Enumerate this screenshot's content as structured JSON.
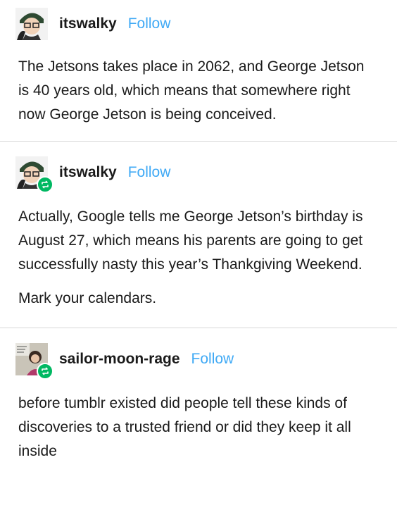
{
  "posts": [
    {
      "username": "itswalky",
      "follow_label": "Follow",
      "avatar_icon": "itswalky-avatar",
      "paragraphs": [
        "The Jetsons takes place in 2062, and George Jetson is 40 years old, which means that somewhere right now George Jetson is being conceived."
      ]
    },
    {
      "username": "itswalky",
      "follow_label": "Follow",
      "avatar_icon": "itswalky-avatar",
      "reblog_icon": "reblog-icon",
      "paragraphs": [
        "Actually, Google tells me George Jetson’s birthday is August 27, which means his parents are going to get successfully nasty this year’s Thankgiving Weekend.",
        "Mark your calendars."
      ]
    },
    {
      "username": "sailor-moon-rage",
      "follow_label": "Follow",
      "avatar_icon": "sailor-moon-avatar",
      "reblog_icon": "reblog-icon",
      "paragraphs": [
        "before tumblr existed did people tell these kinds of discoveries to a trusted friend or did they keep it all inside"
      ]
    }
  ],
  "colors": {
    "follow": "#3fa9f5",
    "reblog_badge": "#00b862",
    "divider": "#d9d9d9"
  }
}
